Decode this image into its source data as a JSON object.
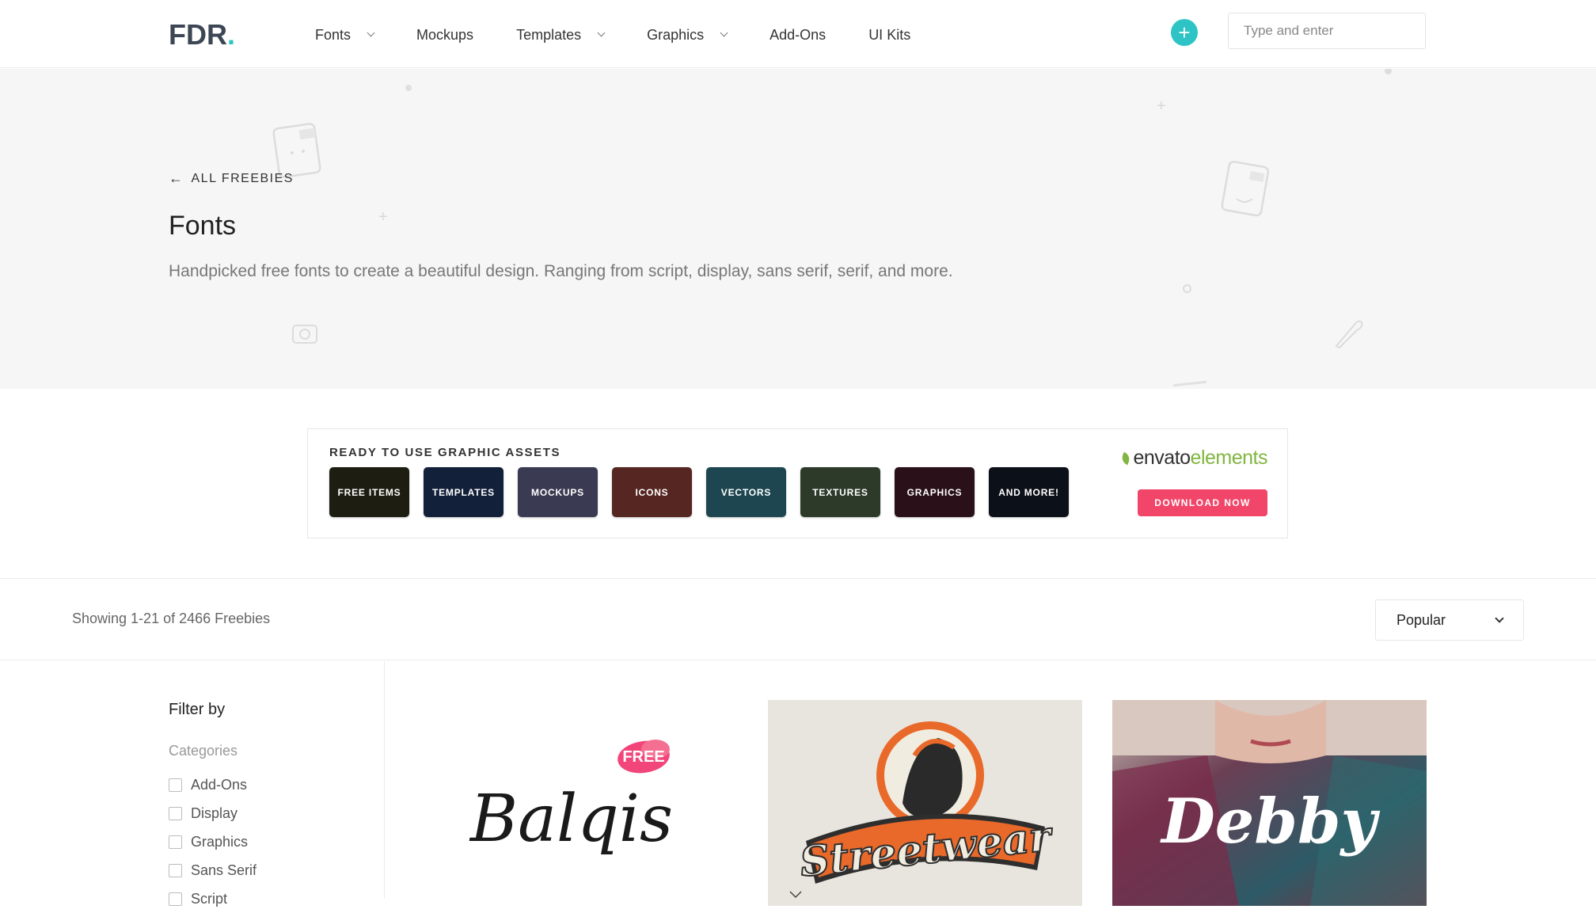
{
  "header": {
    "logo_text": "FDR",
    "logo_dot": ".",
    "nav": [
      {
        "label": "Fonts",
        "has_dropdown": true
      },
      {
        "label": "Mockups",
        "has_dropdown": false
      },
      {
        "label": "Templates",
        "has_dropdown": true
      },
      {
        "label": "Graphics",
        "has_dropdown": true
      },
      {
        "label": "Add-Ons",
        "has_dropdown": false
      },
      {
        "label": "UI Kits",
        "has_dropdown": false
      }
    ],
    "add_icon": "plus-icon",
    "search_placeholder": "Type and enter"
  },
  "hero": {
    "back_link": "ALL FREEBIES",
    "title": "Fonts",
    "description": "Handpicked free fonts to create a beautiful design. Ranging from script, display, sans serif, serif, and more."
  },
  "banner": {
    "title": "READY TO USE GRAPHIC ASSETS",
    "tiles": [
      {
        "label": "FREE ITEMS",
        "color": "#1d1d12"
      },
      {
        "label": "TEMPLATES",
        "color": "#13203a"
      },
      {
        "label": "MOCKUPS",
        "color": "#3a3a52"
      },
      {
        "label": "ICONS",
        "color": "#552622"
      },
      {
        "label": "VECTORS",
        "color": "#1d4650"
      },
      {
        "label": "TEXTURES",
        "color": "#2d3a2a"
      },
      {
        "label": "GRAPHICS",
        "color": "#2a1018"
      },
      {
        "label": "AND MORE!",
        "color": "#0c1018"
      }
    ],
    "brand_a": "envato",
    "brand_b": "elements",
    "cta": "DOWNLOAD NOW"
  },
  "toolbar": {
    "showing": "Showing 1-21 of 2466 Freebies",
    "sort_value": "Popular"
  },
  "sidebar": {
    "filter_title": "Filter by",
    "categories_label": "Categories",
    "categories": [
      "Add-Ons",
      "Display",
      "Graphics",
      "Sans Serif",
      "Script"
    ]
  },
  "cards": [
    {
      "title": "Balqis",
      "badge": "FREE"
    },
    {
      "title": "Streetwear"
    },
    {
      "title": "Debby"
    }
  ],
  "colors": {
    "accent": "#2ec4c6",
    "cta": "#f1466a",
    "envato_green": "#82b541"
  }
}
